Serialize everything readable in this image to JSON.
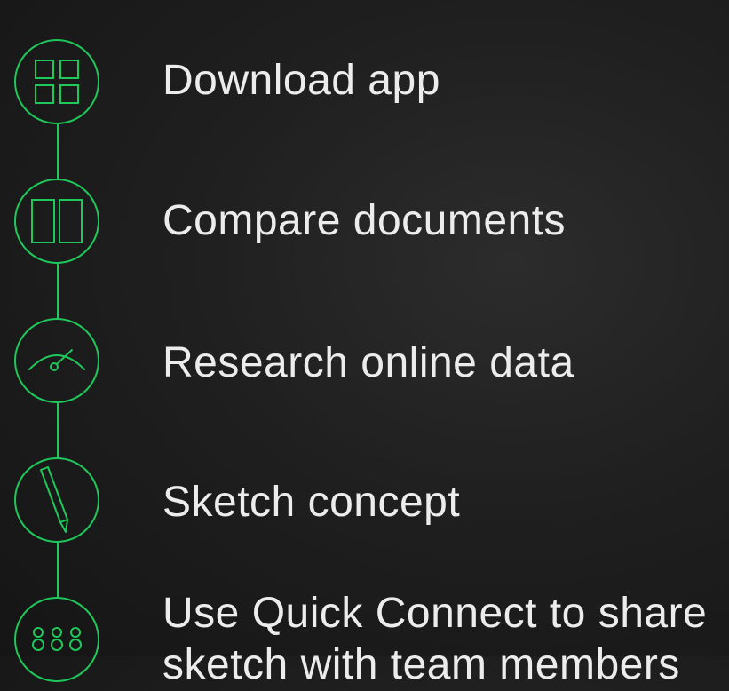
{
  "steps": [
    {
      "label": "Download app",
      "icon": "grid-icon"
    },
    {
      "label": "Compare documents",
      "icon": "compare-columns-icon"
    },
    {
      "label": "Research online data",
      "icon": "gauge-icon"
    },
    {
      "label": "Sketch concept",
      "icon": "pencil-icon"
    },
    {
      "label": "Use Quick Connect to share",
      "continuation": "sketch with team members",
      "icon": "people-group-icon"
    }
  ],
  "colors": {
    "accent": "#1ec85a",
    "text": "#ececec",
    "background": "#1f1f1f"
  }
}
